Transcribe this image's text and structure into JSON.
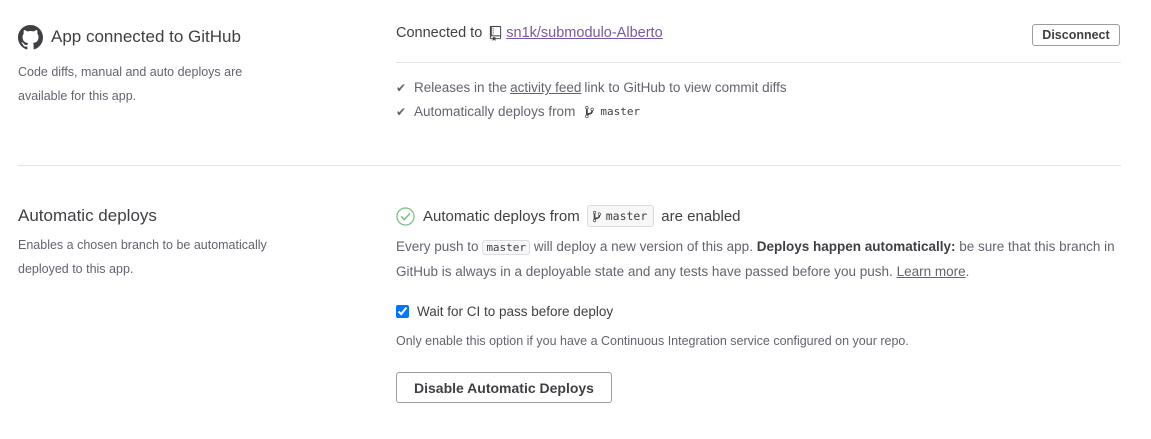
{
  "github_section": {
    "title": "App connected to GitHub",
    "description": "Code diffs, manual and auto deploys are available for this app.",
    "connected_prefix": "Connected to",
    "repo": "sn1k/submodulo-Alberto",
    "disconnect_label": "Disconnect",
    "features": {
      "releases_before": "Releases in the",
      "releases_link": "activity feed",
      "releases_after": "link to GitHub to view commit diffs",
      "auto_deploy_text": "Automatically deploys from",
      "branch": "master"
    }
  },
  "auto_deploys_section": {
    "title": "Automatic deploys",
    "description": "Enables a chosen branch to be automatically deployed to this app.",
    "status_prefix": "Automatic deploys from",
    "branch": "master",
    "status_suffix": "are enabled",
    "info_1": "Every push to",
    "info_branch": "master",
    "info_2": "will deploy a new version of this app.",
    "info_bold": "Deploys happen automatically:",
    "info_3": "be sure that this branch in GitHub is always in a deployable state and any tests have passed before you push.",
    "learn_more": "Learn more",
    "info_end": ".",
    "ci_checkbox_label": "Wait for CI to pass before deploy",
    "ci_checked": true,
    "ci_help": "Only enable this option if you have a Continuous Integration service configured on your repo.",
    "disable_button_label": "Disable Automatic Deploys"
  },
  "colors": {
    "link": "#79589f",
    "success": "#74c080",
    "text": "#3f3f44",
    "muted": "#62646f"
  }
}
